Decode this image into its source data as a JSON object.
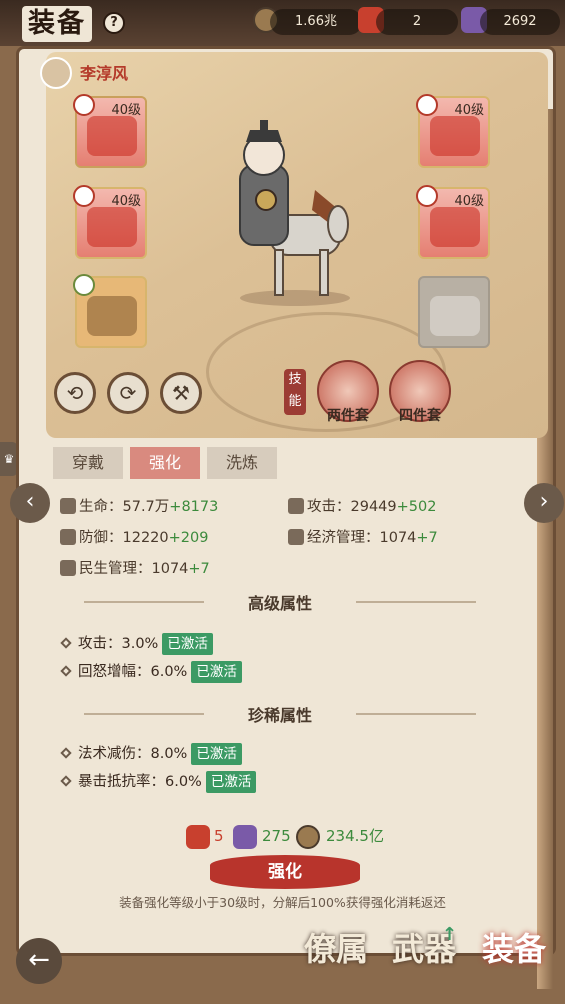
{
  "header": {
    "title": "装备",
    "help_icon": "?",
    "resources": [
      {
        "icon": "coin-icon",
        "value": "1.66兆"
      },
      {
        "icon": "red-ingot-icon",
        "value": "2"
      },
      {
        "icon": "purple-stone-icon",
        "value": "2692"
      }
    ]
  },
  "hero": {
    "name": "李淳风"
  },
  "slots": [
    {
      "level": "40级"
    },
    {
      "level": "40级"
    },
    {
      "level": "40级"
    },
    {
      "level": "40级"
    }
  ],
  "skill_tag": "技能",
  "sets": [
    {
      "label": "两件套"
    },
    {
      "label": "四件套"
    }
  ],
  "tabs": [
    {
      "label": "穿戴"
    },
    {
      "label": "强化"
    },
    {
      "label": "洗炼"
    }
  ],
  "active_tab": 1,
  "stats": [
    {
      "label": "生命：57.7万",
      "plus": "+8173"
    },
    {
      "label": "攻击：29449",
      "plus": "+502"
    },
    {
      "label": "防御：12220",
      "plus": "+209"
    },
    {
      "label": "经济管理：1074",
      "plus": "+7"
    },
    {
      "label": "民生管理：1074",
      "plus": "+7"
    }
  ],
  "sections": [
    {
      "title": "高级属性",
      "rows": [
        {
          "text": "攻击：3.0%",
          "status": "已激活"
        },
        {
          "text": "回怒增幅：6.0%",
          "status": "已激活"
        }
      ]
    },
    {
      "title": "珍稀属性",
      "rows": [
        {
          "text": "法术减伤：8.0%",
          "status": "已激活"
        },
        {
          "text": "暴击抵抗率：6.0%",
          "status": "已激活"
        }
      ]
    }
  ],
  "cost": {
    "ingot": "5",
    "stone": "275",
    "coin": "234.5亿"
  },
  "enhance_button": "强化",
  "note": "装备强化等级小于30级时，分解后100%获得强化消耗返还",
  "bottom_nav": [
    {
      "label": "僚属"
    },
    {
      "label": "武器"
    },
    {
      "label": "装备"
    }
  ],
  "colors": {
    "accent": "#b8342c",
    "active_green": "#3c9a64",
    "plus_green": "#3c8a3c"
  }
}
